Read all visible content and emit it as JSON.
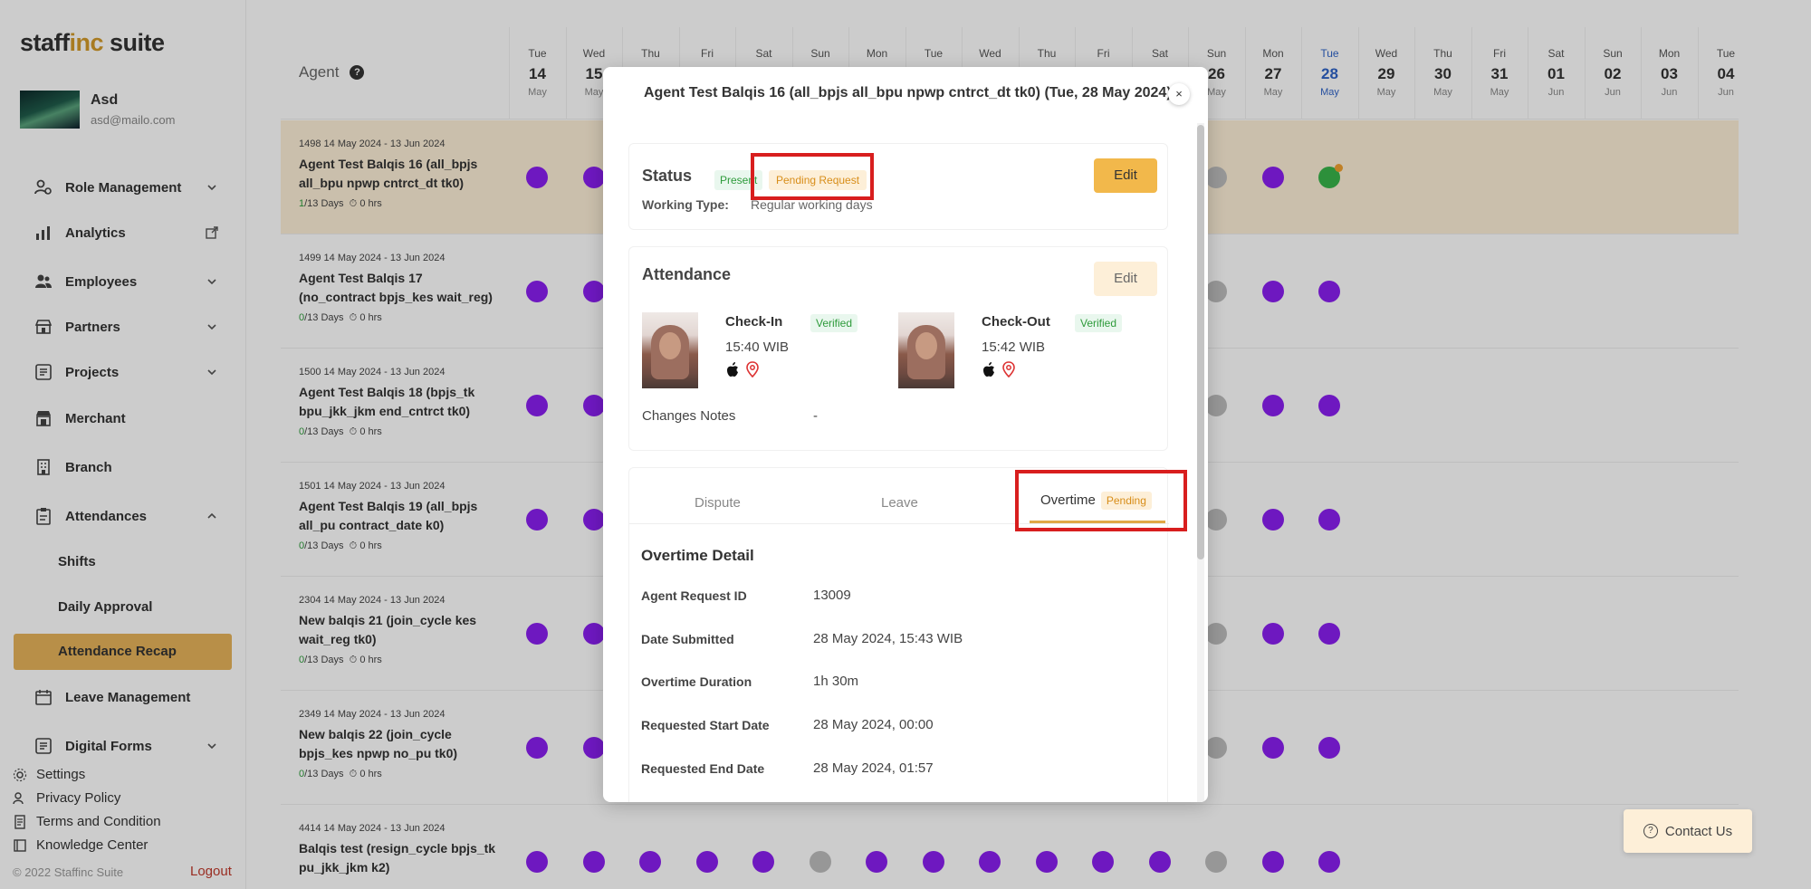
{
  "app": {
    "logo_part1": "staff",
    "logo_part2": "inc",
    "logo_part3": " suite"
  },
  "user": {
    "name": "Asd",
    "email": "asd@mailo.com"
  },
  "sidebar": {
    "items": [
      {
        "label": "Role Management",
        "icon": "role-icon",
        "chevron": true
      },
      {
        "label": "Analytics",
        "icon": "analytics-icon",
        "external": true
      },
      {
        "label": "Employees",
        "icon": "employees-icon",
        "chevron": true
      },
      {
        "label": "Partners",
        "icon": "partners-icon",
        "chevron": true
      },
      {
        "label": "Projects",
        "icon": "projects-icon",
        "chevron": true
      },
      {
        "label": "Merchant",
        "icon": "merchant-icon"
      },
      {
        "label": "Branch",
        "icon": "branch-icon"
      },
      {
        "label": "Attendances",
        "icon": "attendances-icon",
        "chevron_up": true
      },
      {
        "label": "Leave Management",
        "icon": "leave-icon"
      },
      {
        "label": "Digital Forms",
        "icon": "forms-icon",
        "chevron": true
      }
    ],
    "sub_items": [
      "Shifts",
      "Daily Approval",
      "Attendance Recap"
    ],
    "active_sub": "Attendance Recap",
    "footer": [
      "Settings",
      "Privacy Policy",
      "Terms and Condition",
      "Knowledge Center"
    ],
    "copyright": "© 2022 Staffinc Suite",
    "logout": "Logout"
  },
  "calendar": {
    "agent_header": "Agent",
    "help": "?",
    "days": [
      {
        "dow": "Tue",
        "num": "14",
        "mon": "May"
      },
      {
        "dow": "Wed",
        "num": "15",
        "mon": "May"
      },
      {
        "dow": "Thu",
        "num": "16",
        "mon": "May"
      },
      {
        "dow": "Fri",
        "num": "17",
        "mon": "May"
      },
      {
        "dow": "Sat",
        "num": "18",
        "mon": "May"
      },
      {
        "dow": "Sun",
        "num": "19",
        "mon": "May"
      },
      {
        "dow": "Mon",
        "num": "20",
        "mon": "May"
      },
      {
        "dow": "Tue",
        "num": "21",
        "mon": "May"
      },
      {
        "dow": "Wed",
        "num": "22",
        "mon": "May"
      },
      {
        "dow": "Thu",
        "num": "23",
        "mon": "May"
      },
      {
        "dow": "Fri",
        "num": "24",
        "mon": "May"
      },
      {
        "dow": "Sat",
        "num": "25",
        "mon": "May"
      },
      {
        "dow": "Sun",
        "num": "26",
        "mon": "May"
      },
      {
        "dow": "Mon",
        "num": "27",
        "mon": "May"
      },
      {
        "dow": "Tue",
        "num": "28",
        "mon": "May",
        "today": true
      },
      {
        "dow": "Wed",
        "num": "29",
        "mon": "May"
      },
      {
        "dow": "Thu",
        "num": "30",
        "mon": "May"
      },
      {
        "dow": "Fri",
        "num": "31",
        "mon": "May"
      },
      {
        "dow": "Sat",
        "num": "01",
        "mon": "Jun"
      },
      {
        "dow": "Sun",
        "num": "02",
        "mon": "Jun"
      },
      {
        "dow": "Mon",
        "num": "03",
        "mon": "Jun"
      },
      {
        "dow": "Tue",
        "num": "04",
        "mon": "Jun"
      }
    ],
    "rows": [
      {
        "meta": "1498  14 May 2024 - 13 Jun 2024",
        "name": "Agent Test Balqis 16 (all_bpjs all_bpu npwp cntrct_dt tk0)",
        "days_done": "1",
        "days_total": "/13 Days",
        "hrs": "0 hrs",
        "highlight": true,
        "dots": [
          "p",
          "p",
          "",
          "",
          "",
          "",
          "",
          "",
          "",
          "",
          "",
          "",
          "g",
          "p",
          "gr"
        ]
      },
      {
        "meta": "1499  14 May 2024 - 13 Jun 2024",
        "name": "Agent Test Balqis 17 (no_contract bpjs_kes wait_reg)",
        "days_done": "0",
        "days_total": "/13 Days",
        "hrs": "0 hrs",
        "dots": [
          "p",
          "p",
          "",
          "",
          "",
          "",
          "",
          "",
          "",
          "",
          "",
          "",
          "g",
          "p",
          "p"
        ]
      },
      {
        "meta": "1500  14 May 2024 - 13 Jun 2024",
        "name": "Agent Test Balqis 18 (bpjs_tk bpu_jkk_jkm end_cntrct tk0)",
        "days_done": "0",
        "days_total": "/13 Days",
        "hrs": "0 hrs",
        "dots": [
          "p",
          "p",
          "",
          "",
          "",
          "",
          "",
          "",
          "",
          "",
          "",
          "",
          "g",
          "p",
          "p"
        ]
      },
      {
        "meta": "1501  14 May 2024 - 13 Jun 2024",
        "name": "Agent Test Balqis 19 (all_bpjs all_pu contract_date k0)",
        "days_done": "0",
        "days_total": "/13 Days",
        "hrs": "0 hrs",
        "dots": [
          "p",
          "p",
          "",
          "",
          "",
          "",
          "",
          "",
          "",
          "",
          "",
          "",
          "g",
          "p",
          "p"
        ]
      },
      {
        "meta": "2304  14 May 2024 - 13 Jun 2024",
        "name": "New balqis 21 (join_cycle kes wait_reg tk0)",
        "days_done": "0",
        "days_total": "/13 Days",
        "hrs": "0 hrs",
        "dots": [
          "p",
          "p",
          "",
          "",
          "",
          "",
          "",
          "",
          "",
          "",
          "",
          "",
          "g",
          "p",
          "p"
        ]
      },
      {
        "meta": "2349  14 May 2024 - 13 Jun 2024",
        "name": "New balqis 22 (join_cycle bpjs_kes npwp no_pu tk0)",
        "days_done": "0",
        "days_total": "/13 Days",
        "hrs": "0 hrs",
        "dots": [
          "p",
          "p",
          "",
          "",
          "",
          "",
          "",
          "",
          "",
          "",
          "",
          "",
          "g",
          "p",
          "p"
        ]
      },
      {
        "meta": "4414  14 May 2024 - 13 Jun 2024",
        "name": "Balqis test (resign_cycle bpjs_tk pu_jkk_jkm k2)",
        "days_done": "",
        "days_total": "",
        "hrs": "",
        "dots": [
          "p",
          "p",
          "p",
          "p",
          "p",
          "g",
          "p",
          "p",
          "p",
          "p",
          "p",
          "p",
          "g",
          "p",
          "p"
        ]
      }
    ]
  },
  "contact": {
    "label": "Contact Us"
  },
  "modal": {
    "title": "Agent Test Balqis 16 (all_bpjs all_bpu npwp cntrct_dt tk0) (Tue, 28 May 2024)",
    "close": "×",
    "status": {
      "title": "Status",
      "present": "Present",
      "pending": "Pending Request",
      "working_type_label": "Working Type:",
      "working_type_value": "Regular working days",
      "edit": "Edit"
    },
    "attendance": {
      "title": "Attendance",
      "edit": "Edit",
      "check_in_label": "Check-In",
      "check_in_status": "Verified",
      "check_in_time": "15:40 WIB",
      "check_out_label": "Check-Out",
      "check_out_status": "Verified",
      "check_out_time": "15:42 WIB",
      "notes_label": "Changes Notes",
      "notes_value": "-"
    },
    "tabs": {
      "dispute": "Dispute",
      "leave": "Leave",
      "overtime": "Overtime",
      "overtime_badge": "Pending"
    },
    "overtime": {
      "title": "Overtime Detail",
      "fields": [
        {
          "label": "Agent Request ID",
          "value": "13009"
        },
        {
          "label": "Date Submitted",
          "value": "28 May 2024, 15:43 WIB"
        },
        {
          "label": "Overtime Duration",
          "value": "1h 30m"
        },
        {
          "label": "Requested Start Date",
          "value": "28 May 2024, 00:00"
        },
        {
          "label": "Requested End Date",
          "value": "28 May 2024, 01:57"
        }
      ]
    }
  },
  "colors": {
    "accent": "#e7b35a",
    "present_dot": "#8a1ff0",
    "highlight": "#d81e1e"
  }
}
